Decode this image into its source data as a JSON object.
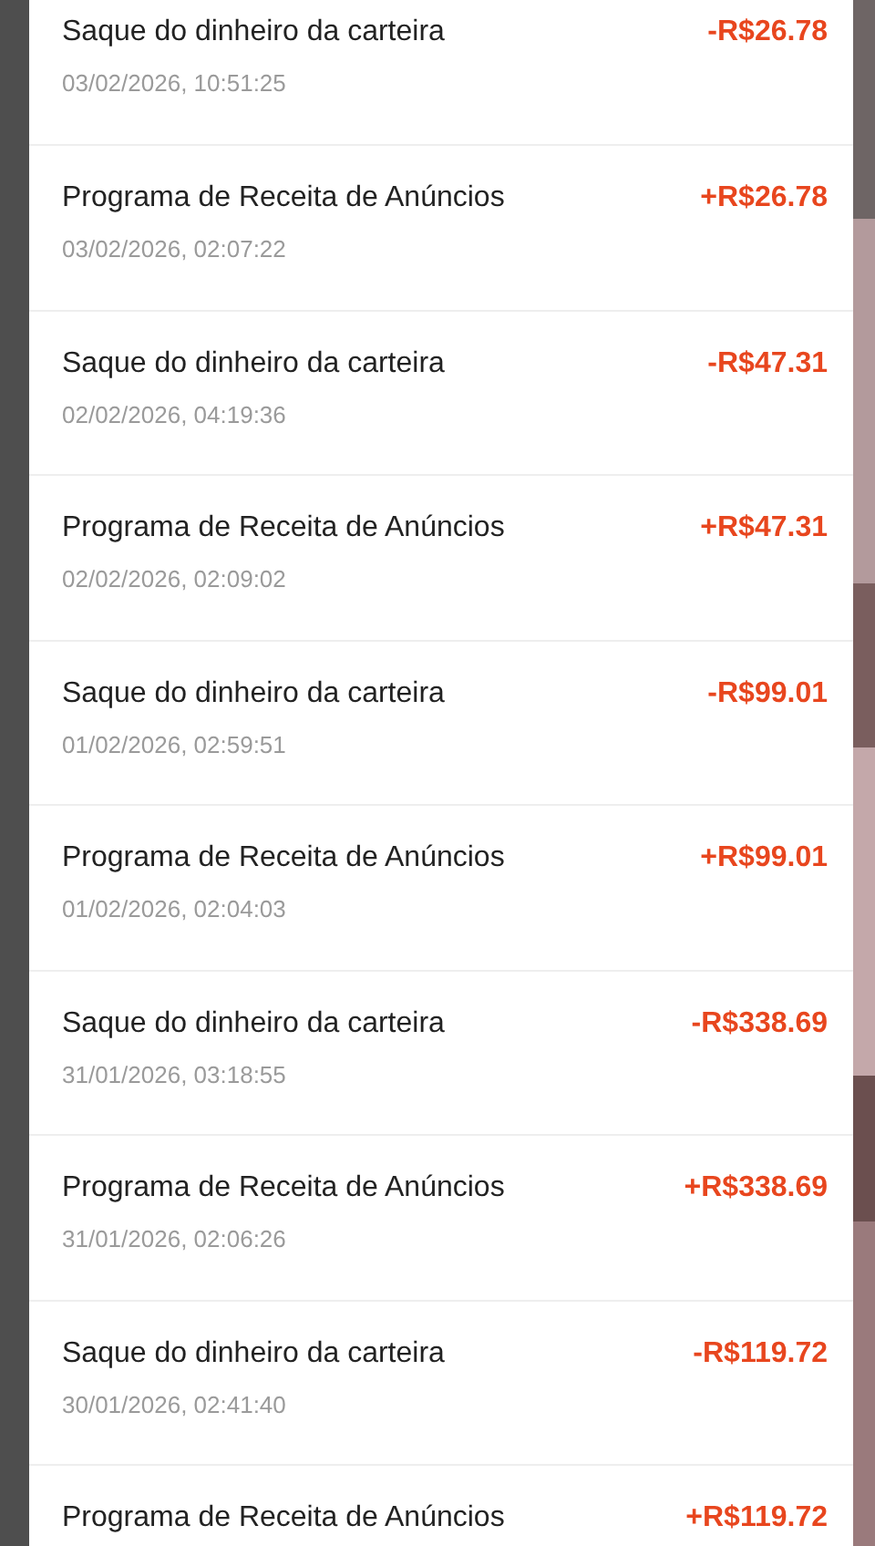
{
  "transactions": [
    {
      "title": "Saque do dinheiro da carteira",
      "date": "03/02/2026, 10:51:25",
      "amount": "-R$26.78"
    },
    {
      "title": "Programa de Receita de Anúncios",
      "date": "03/02/2026, 02:07:22",
      "amount": "+R$26.78"
    },
    {
      "title": "Saque do dinheiro da carteira",
      "date": "02/02/2026, 04:19:36",
      "amount": "-R$47.31"
    },
    {
      "title": "Programa de Receita de Anúncios",
      "date": "02/02/2026, 02:09:02",
      "amount": "+R$47.31"
    },
    {
      "title": "Saque do dinheiro da carteira",
      "date": "01/02/2026, 02:59:51",
      "amount": "-R$99.01"
    },
    {
      "title": "Programa de Receita de Anúncios",
      "date": "01/02/2026, 02:04:03",
      "amount": "+R$99.01"
    },
    {
      "title": "Saque do dinheiro da carteira",
      "date": "31/01/2026, 03:18:55",
      "amount": "-R$338.69"
    },
    {
      "title": "Programa de Receita de Anúncios",
      "date": "31/01/2026, 02:06:26",
      "amount": "+R$338.69"
    },
    {
      "title": "Saque do dinheiro da carteira",
      "date": "30/01/2026, 02:41:40",
      "amount": "-R$119.72"
    },
    {
      "title": "Programa de Receita de Anúncios",
      "amount": "+R$119.72"
    }
  ]
}
